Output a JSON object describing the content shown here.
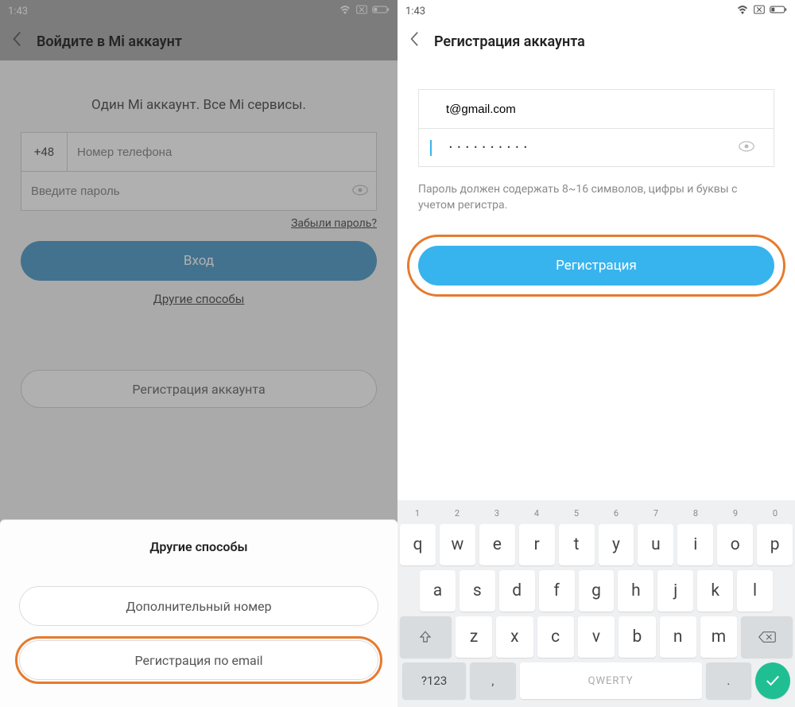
{
  "statusbar": {
    "time": "1:43"
  },
  "left": {
    "title": "Войдите в Mi аккаунт",
    "headline": "Один Mi аккаунт. Все Mi сервисы.",
    "country_prefix": "+48",
    "phone_placeholder": "Номер телефона",
    "password_placeholder": "Введите пароль",
    "forgot": "Забыли пароль?",
    "login_btn": "Вход",
    "other_methods": "Другие способы",
    "register_btn": "Регистрация аккаунта",
    "sheet": {
      "title": "Другие способы",
      "option1": "Дополнительный номер",
      "option2": "Регистрация по email"
    }
  },
  "right": {
    "title": "Регистрация аккаунта",
    "email_value": "t@gmail.com",
    "password_masked": "• • • • • • • • • •",
    "hint": "Пароль должен содержать 8~16 символов, цифры и буквы с учетом регистра.",
    "register_btn": "Регистрация"
  },
  "keyboard": {
    "nums": [
      "1",
      "2",
      "3",
      "4",
      "5",
      "6",
      "7",
      "8",
      "9",
      "0"
    ],
    "row1": [
      "q",
      "w",
      "e",
      "r",
      "t",
      "y",
      "u",
      "i",
      "o",
      "p"
    ],
    "row2": [
      "a",
      "s",
      "d",
      "f",
      "g",
      "h",
      "j",
      "k",
      "l"
    ],
    "row3": [
      "z",
      "x",
      "c",
      "v",
      "b",
      "n",
      "m"
    ],
    "switch": "?123",
    "lang": ",",
    "space": "QWERTY",
    "period": "."
  }
}
